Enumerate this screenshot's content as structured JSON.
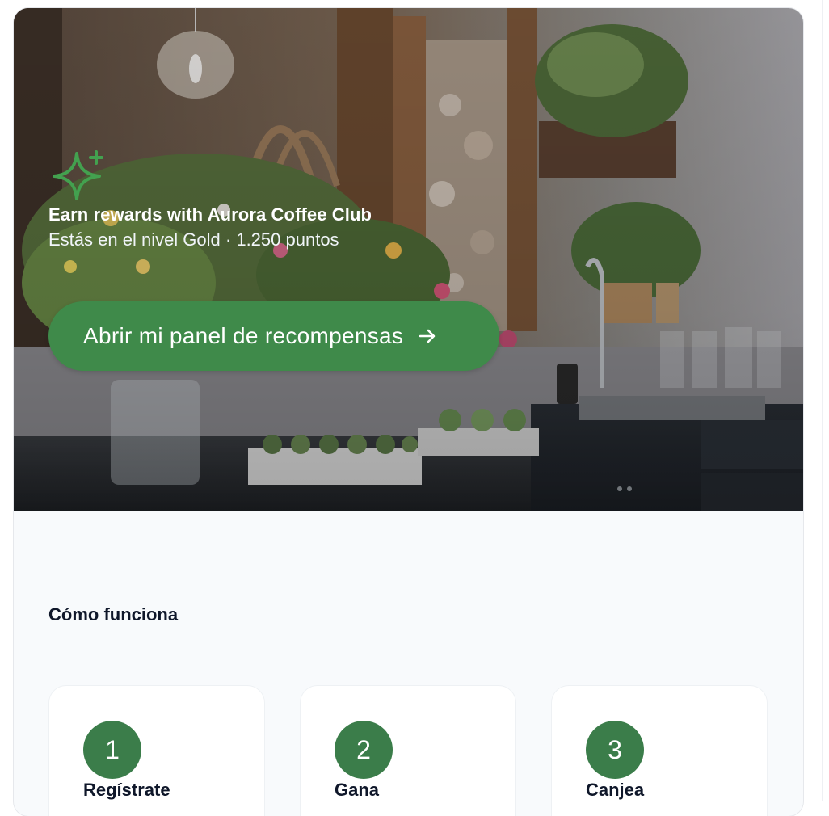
{
  "hero": {
    "icon": "sparkle-icon",
    "title": "Earn rewards with Aurora Coffee Club",
    "subtitle": "Estás en el nivel Gold · 1.250 puntos",
    "cta_label": "Abrir mi panel de recompensas",
    "cta_icon": "arrow-right-icon"
  },
  "how_it_works": {
    "title": "Cómo funciona",
    "steps": [
      {
        "number": "1",
        "label": "Regístrate"
      },
      {
        "number": "2",
        "label": "Gana"
      },
      {
        "number": "3",
        "label": "Canjea"
      }
    ]
  },
  "colors": {
    "accent": "#3f8a4a",
    "step_badge": "#3b7d4a",
    "background": "#f8fafc"
  }
}
